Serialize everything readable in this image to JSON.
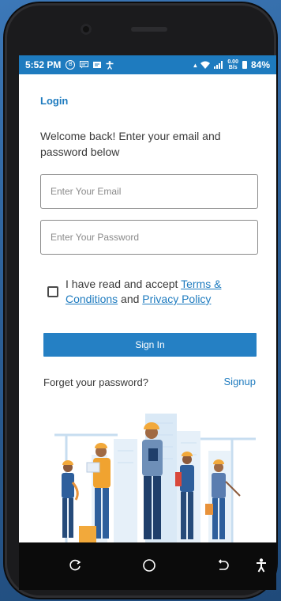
{
  "status_bar": {
    "time": "5:52 PM",
    "left_icons": [
      "b-circle-icon",
      "message-icon",
      "subtitles-icon",
      "accessibility-icon"
    ],
    "b_badge": "B",
    "net_speed_top": "0.00",
    "net_speed_bottom": "B/s",
    "battery": "84%"
  },
  "page": {
    "title": "Login",
    "welcome": "Welcome back! Enter your email and password below"
  },
  "form": {
    "email_placeholder": "Enter Your Email",
    "email_value": "",
    "password_placeholder": "Enter Your Password",
    "password_value": "",
    "terms_prefix": "I have read and accept ",
    "terms_link": "Terms & Conditions",
    "terms_and": " and ",
    "privacy_link": "Privacy Policy",
    "checkbox_checked": false,
    "signin_label": "Sign In",
    "forgot_label": "Forget your password?",
    "signup_label": "Signup"
  },
  "colors": {
    "accent": "#1e7bbf",
    "button": "#2580c4",
    "status_bar": "#1e7bbf"
  },
  "navbar": {
    "icons": [
      "recent-apps-icon",
      "home-icon",
      "back-icon",
      "accessibility-icon"
    ]
  }
}
